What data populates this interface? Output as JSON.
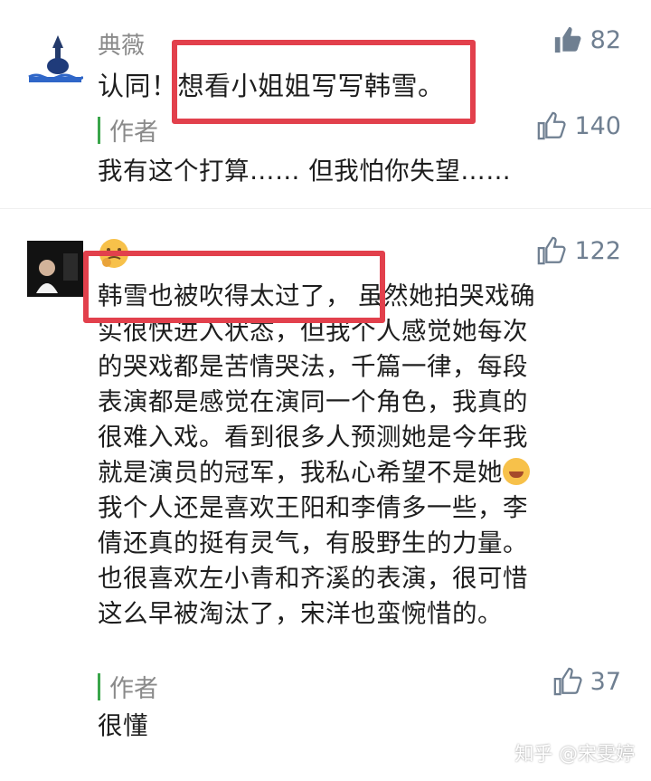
{
  "comments": [
    {
      "username": "典薇",
      "likes": "82",
      "text_prefix": "认同！",
      "text_highlight": "想看小姐姐写写韩雪。",
      "reply": {
        "label": "作者",
        "likes": "140",
        "text": "我有这个打算…… 但我怕你失望……"
      }
    },
    {
      "username": "",
      "likes": "122",
      "text_highlight": "韩雪也被吹得太过了，",
      "lines": [
        "虽然她拍哭戏确",
        "实很快进入状态，但我个人感觉她每次",
        "的哭戏都是苦情哭法，千篇一律，每段",
        "表演都是感觉在演同一个角色，我真的",
        "很难入戏。看到很多人预测她是今年我",
        "就是演员的冠军，我私心希望不是她",
        "我个人还是喜欢王阳和李倩多一些，李",
        "倩还真的挺有灵气，有股野生的力量。",
        "也很喜欢左小青和齐溪的表演，很可惜",
        "这么早被淘汰了，宋洋也蛮惋惜的。"
      ],
      "reply": {
        "label": "作者",
        "likes": "37",
        "text": "很懂"
      }
    }
  ],
  "watermark": "知乎 @宋雯婷",
  "colors": {
    "highlight": "#e2404c",
    "like": "#6f7f91",
    "reply_bar": "#3aa54a"
  },
  "icons": {
    "like": "thumbs-up-icon",
    "emoji_name": "thinking-face-emoji",
    "emoji_inline": "crying-laughing-emoji"
  }
}
